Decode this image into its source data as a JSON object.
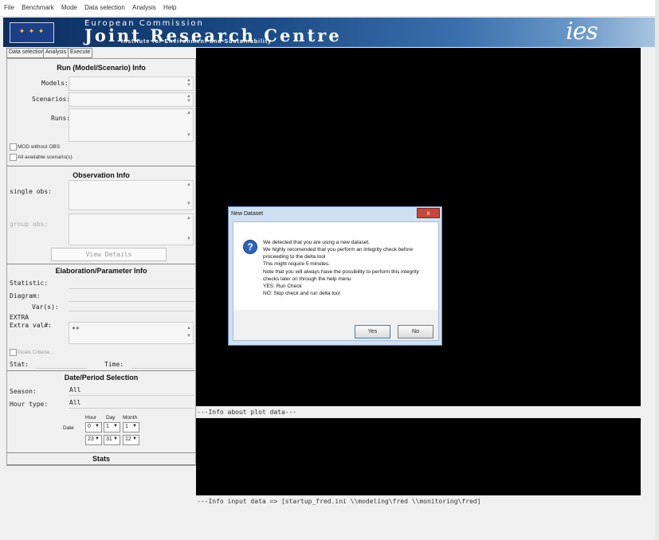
{
  "menu": {
    "items": [
      "File",
      "Benchmark",
      "Mode",
      "Data selection",
      "Analysis",
      "Help"
    ]
  },
  "banner": {
    "top": "European Commission",
    "main": "Joint Research Centre",
    "sub": "Institute for Environment and Sustainability",
    "logo": "ies"
  },
  "tabs": [
    "Data selection",
    "Analysis",
    "Execute"
  ],
  "run_info": {
    "title": "Run (Model/Scenario) Info",
    "models_label": "Models:",
    "scenarios_label": "Scenarios:",
    "runs_label": "Runs:",
    "mod_without_obs": "MOD without OBS",
    "all_scenarios": "All available scenario(s)"
  },
  "obs_info": {
    "title": "Observation Info",
    "single_label": "single obs:",
    "group_label": "group obs:",
    "view_details": "View Details"
  },
  "elab_info": {
    "title": "Elaboration/Parameter Info",
    "statistic_label": "Statistic:",
    "diagram_label": "Diagram:",
    "vars_label": "Var(s):",
    "extra_label": "EXTRA",
    "extra_val_label": "Extra val#:",
    "extra_val_value": "**",
    "goals_criteria": "Goals Criteria...",
    "stat_label": "Stat:",
    "time_label": "Time:"
  },
  "date_period": {
    "title": "Date/Period Selection",
    "season_label": "Season:",
    "season_value": "All",
    "hour_type_label": "Hour type:",
    "hour_type_value": "All",
    "col_hour": "Hour",
    "col_day": "Day",
    "col_month": "Month",
    "date_label": "Date",
    "start_hour": "0",
    "start_day": "1",
    "start_month": "1",
    "end_hour": "23",
    "end_day": "31",
    "end_month": "12"
  },
  "stats": {
    "title": "Stats"
  },
  "plot_info": "---Info about plot data---",
  "input_info": "---Info input data =>  [startup_fred.ini   \\\\modeling\\fred   \\\\monitoring\\fred]",
  "dialog": {
    "title": "New Dataset",
    "lines": [
      "We detected that you are using a new dataset.",
      "We highly recomended that you perform an integrity check before",
      "proceeding to the delta tool",
      "This might require 5 minutes.",
      "Note that you will always have the possibility to perform this integrity",
      "checks later on through the help menu",
      "YES: Run Check",
      "NO: Skip check and run delta tool"
    ],
    "yes": "Yes",
    "no": "No",
    "close": "x"
  }
}
